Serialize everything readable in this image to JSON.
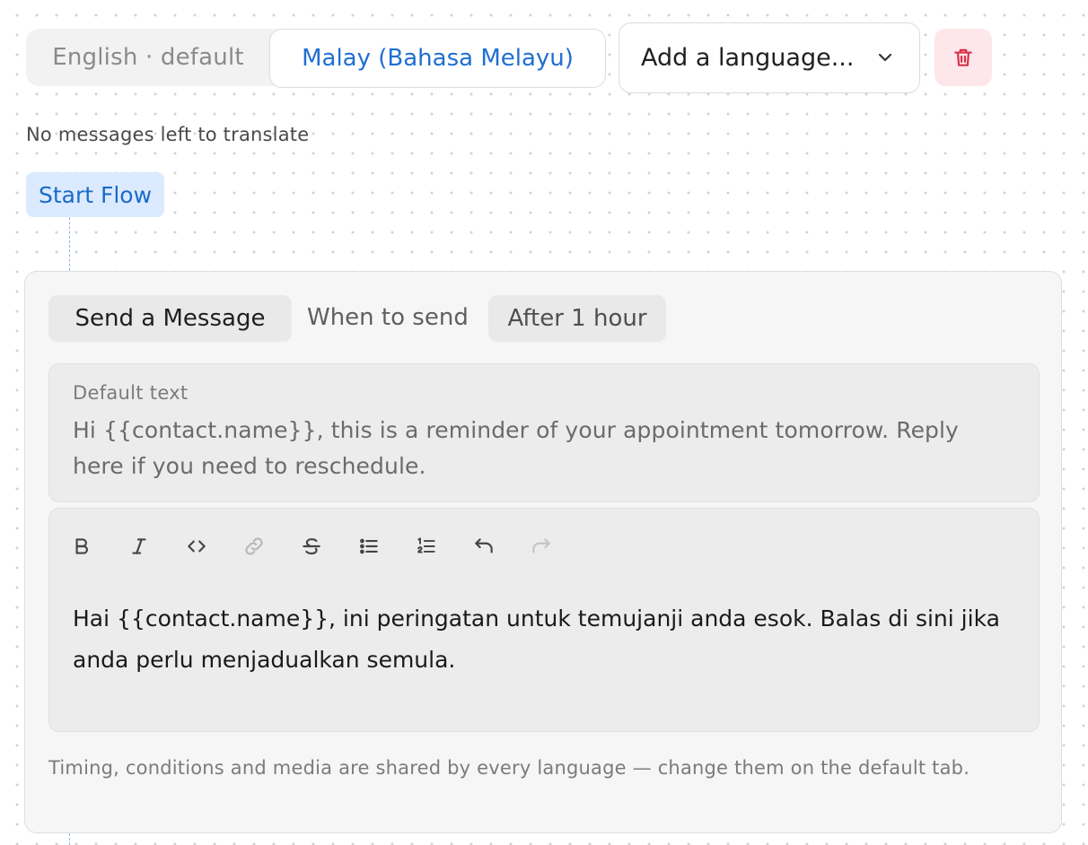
{
  "languages": {
    "default_tab": "English · default",
    "active_tab": "Malay (Bahasa Melayu)",
    "add_placeholder": "Add a language...",
    "delete_icon": "trash-icon"
  },
  "status": {
    "text": "No messages left to translate"
  },
  "flow": {
    "start_label": "Start Flow"
  },
  "step": {
    "type_label": "Send a Message",
    "when_label": "When to send",
    "timing_label": "After 1 hour",
    "default_label": "Default text",
    "default_text": "Hi {{contact.name}}, this is a reminder of your appointment tomorrow. Reply here if you need to reschedule.",
    "toolbar": [
      {
        "name": "bold-icon",
        "enabled": true
      },
      {
        "name": "italic-icon",
        "enabled": true
      },
      {
        "name": "code-icon",
        "enabled": true
      },
      {
        "name": "link-icon",
        "enabled": false
      },
      {
        "name": "strikethrough-icon",
        "enabled": true
      },
      {
        "name": "bullet-list-icon",
        "enabled": true
      },
      {
        "name": "ordered-list-icon",
        "enabled": true
      },
      {
        "name": "undo-icon",
        "enabled": true
      },
      {
        "name": "redo-icon",
        "enabled": false
      }
    ],
    "translation_text": "Hai {{contact.name}}, ini peringatan untuk temujanji anda esok. Balas di sini jika anda perlu menjadualkan semula.",
    "footer_note": "Timing, conditions and media are shared by every language — change them on the default tab."
  },
  "colors": {
    "accent": "#1f6fd1",
    "start_bg": "#dbeafe",
    "delete_bg": "#fde7ea",
    "delete_icon": "#d6304a"
  }
}
